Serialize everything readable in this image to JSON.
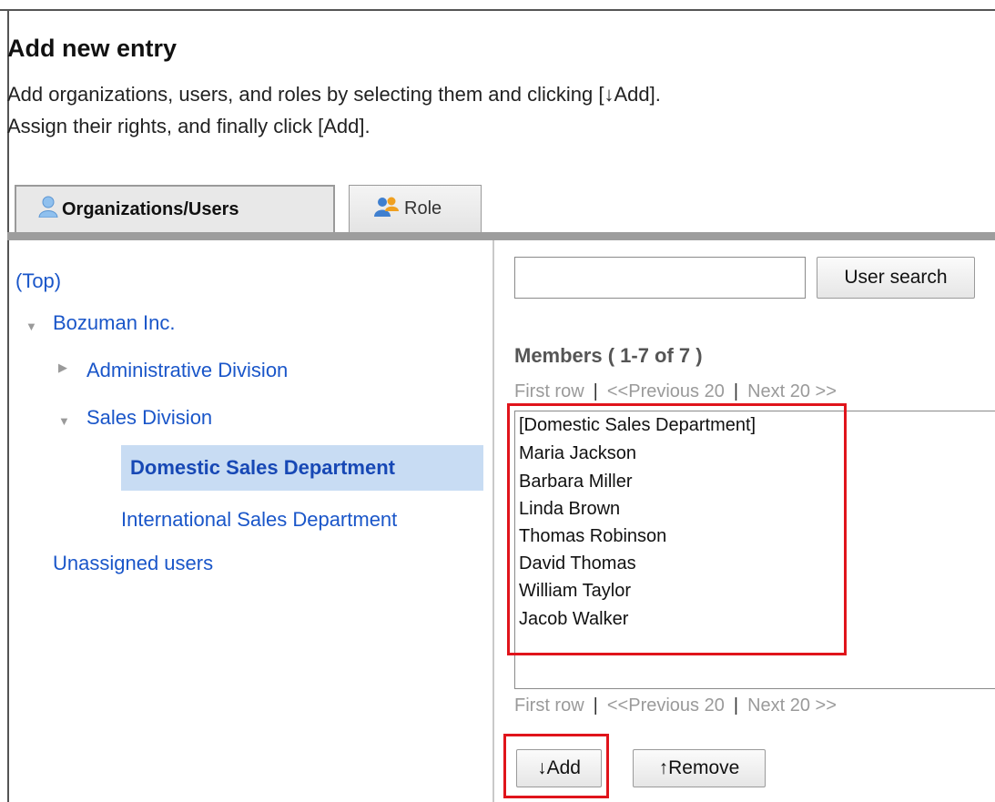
{
  "page": {
    "title": "Add new entry",
    "description_line1": "Add organizations, users, and roles by selecting them and clicking [↓Add].",
    "description_line2": "Assign their rights, and finally click [Add]."
  },
  "tabs": [
    {
      "label": "Organizations/Users",
      "icon": "user-icon",
      "active": true
    },
    {
      "label": "Role",
      "icon": "role-icon",
      "active": false
    }
  ],
  "tree": {
    "top": "(Top)",
    "root": "Bozuman Inc.",
    "children": [
      {
        "label": "Administrative Division",
        "state": "collapsed"
      },
      {
        "label": "Sales Division",
        "state": "expanded",
        "children": [
          {
            "label": "Domestic Sales Department",
            "selected": true
          },
          {
            "label": "International Sales Department",
            "selected": false
          }
        ]
      }
    ],
    "unassigned": "Unassigned users"
  },
  "search": {
    "value": "",
    "button_label": "User search"
  },
  "members": {
    "title": "Members ( 1-7 of 7 )",
    "pager": {
      "first": "First row",
      "separator": "|",
      "previous": "<<Previous 20",
      "next": "Next 20 >>"
    },
    "items": [
      "[Domestic Sales Department]",
      "Maria Jackson",
      "Barbara Miller",
      "Linda Brown",
      "Thomas Robinson",
      "David Thomas",
      "William Taylor",
      "Jacob Walker"
    ]
  },
  "actions": {
    "add_label": "↓Add",
    "remove_label": "↑Remove"
  },
  "colors": {
    "link": "#1a56c9",
    "selected_bg": "#c8dcf3",
    "highlight": "#e0141b"
  }
}
